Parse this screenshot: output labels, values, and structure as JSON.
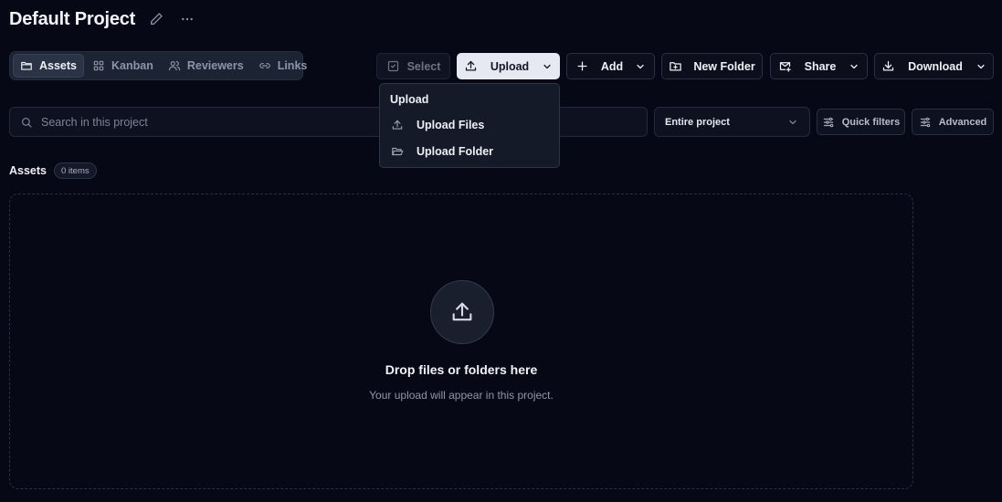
{
  "project": {
    "title": "Default Project"
  },
  "view_tabs": [
    {
      "label": "Assets",
      "icon": "folder-icon",
      "active": true
    },
    {
      "label": "Kanban",
      "icon": "grid-icon",
      "active": false
    },
    {
      "label": "Reviewers",
      "icon": "users-icon",
      "active": false
    },
    {
      "label": "Links",
      "icon": "link-icon",
      "active": false
    }
  ],
  "toolbar": {
    "select_label": "Select",
    "upload_label": "Upload",
    "add_label": "Add",
    "new_folder_label": "New Folder",
    "share_label": "Share",
    "download_label": "Download"
  },
  "upload_menu": {
    "title": "Upload",
    "items": [
      {
        "label": "Upload Files",
        "icon": "upload-icon"
      },
      {
        "label": "Upload Folder",
        "icon": "folder-open-icon"
      }
    ]
  },
  "search": {
    "placeholder": "Search in this project",
    "value": ""
  },
  "scope": {
    "selected": "Entire project"
  },
  "filters": {
    "quick_label": "Quick filters",
    "advanced_label": "Advanced"
  },
  "assets_section": {
    "title": "Assets",
    "count": "0 items"
  },
  "dropzone": {
    "title": "Drop files or folders here",
    "subtitle": "Your upload will appear in this project."
  },
  "colors": {
    "background": "#070815",
    "panel": "#1c2333",
    "primary_button": "#e6e9f2",
    "border": "#2a3040",
    "muted_text": "#9096a8"
  }
}
